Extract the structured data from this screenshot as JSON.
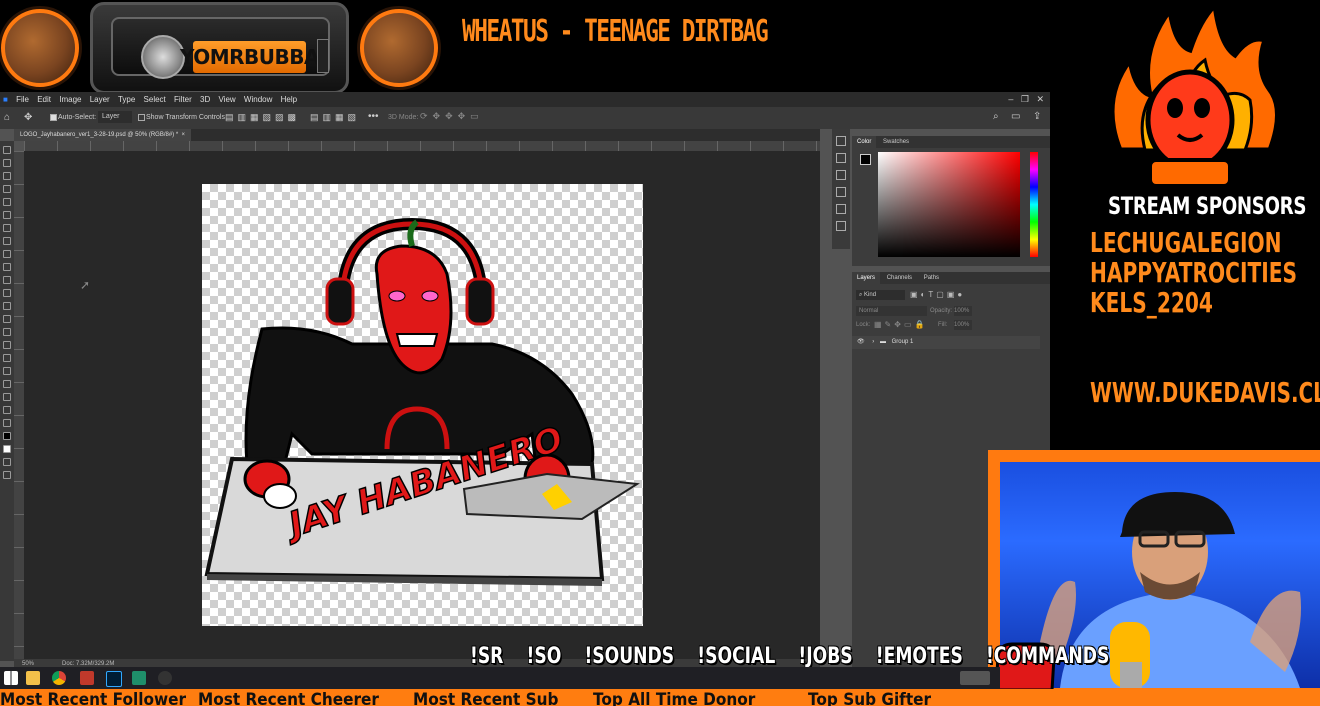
{
  "overlay": {
    "radio_display": "YOMRBUBBA",
    "now_playing": "WHEATUS - TEENAGE DIRTBAG",
    "sponsors_title": "STREAM SPONSORS",
    "sponsors": [
      "LECHUGALEGION",
      "HAPPYATROCITIES",
      "KELS_2204"
    ],
    "website": "WWW.DUKEDAVIS.CLUB",
    "chat_commands": [
      "!SR",
      "!SO",
      "!SOUNDS",
      "!SOCIAL",
      "!JOBS",
      "!EMOTES",
      "!COMMANDS"
    ],
    "ticker": [
      "Most Recent Follower",
      "Most Recent Cheerer",
      "Most Recent Sub",
      "Top All Time Donor",
      "Top Sub Gifter"
    ],
    "accent_color": "#ff7d10"
  },
  "photoshop": {
    "menu": [
      "File",
      "Edit",
      "Image",
      "Layer",
      "Type",
      "Select",
      "Filter",
      "3D",
      "View",
      "Window",
      "Help"
    ],
    "options": {
      "auto_select": "Auto-Select:",
      "auto_select_target": "Layer",
      "show_transform": "Show Transform Controls",
      "mode_3d": "3D Mode:"
    },
    "document_tab": "LOGO_Jayhabanero_ver1_3-28-19.psd @ 50% (RGB/8#) *",
    "ruler_ticks": [
      "300",
      "200",
      "100",
      "0",
      "100",
      "200",
      "300",
      "400",
      "500",
      "600",
      "700",
      "800",
      "900",
      "1000",
      "1100",
      "1200",
      "1300",
      "1400",
      "1500",
      "1600",
      "1700",
      "1800",
      "1900",
      "2000"
    ],
    "status": {
      "zoom": "50%",
      "doc_size": "Doc: 7.32M/329.2M"
    },
    "color_panel": {
      "tabs": [
        "Color",
        "Swatches"
      ],
      "hue": "#ff0000"
    },
    "layers_panel": {
      "tabs": [
        "Layers",
        "Channels",
        "Paths"
      ],
      "filter": "Kind",
      "blend_mode": "Normal",
      "opacity_label": "Opacity:",
      "opacity_value": "100%",
      "lock_label": "Lock:",
      "fill_label": "Fill:",
      "fill_value": "100%",
      "layers": [
        {
          "name": "Group 1",
          "visible": true
        }
      ]
    },
    "artwork_text": "JAY HABANERO"
  }
}
